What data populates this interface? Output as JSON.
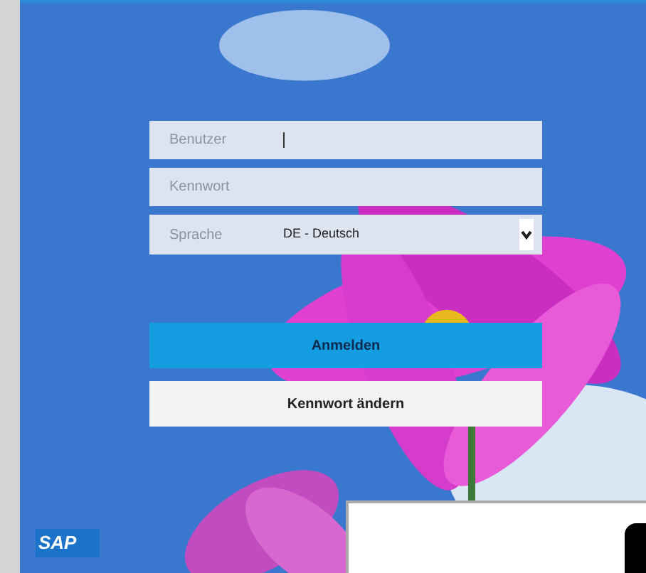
{
  "login_form": {
    "fields": [
      {
        "label": "Benutzer",
        "focused": true
      },
      {
        "label": "Kennwort",
        "focused": false
      }
    ],
    "language": {
      "label": "Sprache",
      "value": "DE - Deutsch"
    },
    "buttons": [
      {
        "label": "Anmelden",
        "kind": "primary"
      },
      {
        "label": "Kennwort ändern",
        "kind": "secondary"
      }
    ]
  },
  "logo": {
    "text": "SAP"
  }
}
